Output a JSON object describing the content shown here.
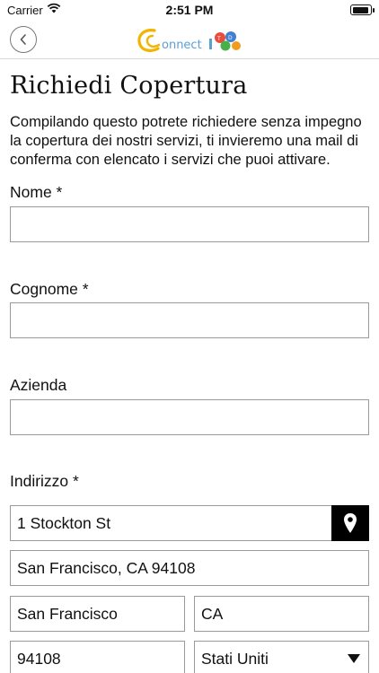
{
  "status_bar": {
    "carrier": "Carrier",
    "time": "2:51 PM",
    "battery_level": 0.95
  },
  "nav": {
    "logo_text": "onnect",
    "logo_accent_color": "#f2b400",
    "logo_text_color": "#5a9fd4"
  },
  "page": {
    "title": "Richiedi Copertura",
    "intro": "Compilando questo potrete richiedere senza impegno la copertura dei nostri servizi, ti invieremo una mail di conferma con elencato i servizi che puoi attivare."
  },
  "form": {
    "nome": {
      "label": "Nome *",
      "value": ""
    },
    "cognome": {
      "label": "Cognome *",
      "value": ""
    },
    "azienda": {
      "label": "Azienda",
      "value": ""
    },
    "indirizzo": {
      "label": "Indirizzo *",
      "street": "1 Stockton St",
      "full_address": "San Francisco, CA  94108",
      "city": "San Francisco",
      "state": "CA",
      "zip": "94108",
      "country": "Stati Uniti"
    }
  }
}
